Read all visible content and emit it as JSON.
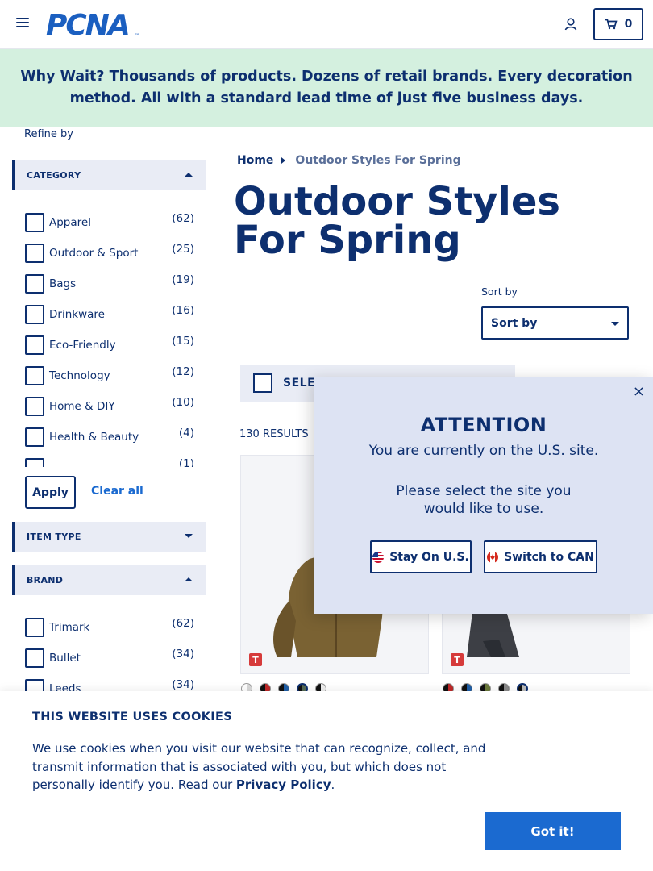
{
  "header": {
    "logo_text": "PCNA",
    "cart_count": "0",
    "icons": [
      "menu-icon",
      "account-icon",
      "cart-icon"
    ]
  },
  "banner": {
    "text": "Why Wait? Thousands of products. Dozens of retail brands. Every decoration method. All with a standard lead time of just five business days."
  },
  "sidebar": {
    "refine_label": "Refine by",
    "category": {
      "title": "CATEGORY",
      "items": [
        {
          "label": "Apparel",
          "count": "(62)"
        },
        {
          "label": "Outdoor & Sport",
          "count": "(25)"
        },
        {
          "label": "Bags",
          "count": "(19)"
        },
        {
          "label": "Drinkware",
          "count": "(16)"
        },
        {
          "label": "Eco-Friendly",
          "count": "(15)"
        },
        {
          "label": "Technology",
          "count": "(12)"
        },
        {
          "label": "Home & DIY",
          "count": "(10)"
        },
        {
          "label": "Health & Beauty",
          "count": "(4)"
        },
        {
          "label": "",
          "count": "(1)"
        }
      ]
    },
    "apply_label": "Apply",
    "clear_label": "Clear all",
    "item_type": {
      "title": "ITEM TYPE"
    },
    "brand": {
      "title": "BRAND",
      "items": [
        {
          "label": "Trimark",
          "count": "(62)"
        },
        {
          "label": "Bullet",
          "count": "(34)"
        },
        {
          "label": "Leeds",
          "count": "(34)"
        }
      ]
    }
  },
  "main": {
    "breadcrumb": {
      "home": "Home",
      "current": "Outdoor Styles For Spring"
    },
    "title": "Outdoor Styles For Spring",
    "sort_label": "Sort by",
    "sort_value": "Sort by",
    "select_all": "SELECT",
    "results": "130 RESULTS",
    "product_badge": "T"
  },
  "modal": {
    "title": "ATTENTION",
    "line1": "You are currently on the U.S. site.",
    "line2": "Please select the site you",
    "line3": "would like to use.",
    "stay_label": "Stay On U.S.",
    "switch_label": "Switch to CAN",
    "close": "×"
  },
  "cookie": {
    "title": "THIS WEBSITE USES COOKIES",
    "text": "We use cookies when you visit our website that can recognize, collect, and transmit information that is associated with you, but which does not personally identify you. Read our ",
    "link": "Privacy Policy",
    "end": ".",
    "button": "Got it!"
  },
  "colors": {
    "navy": "#0d2f6f",
    "banner_bg": "#d4f0df",
    "link_blue": "#1b6ad0",
    "modal_bg": "#dde3f3"
  }
}
